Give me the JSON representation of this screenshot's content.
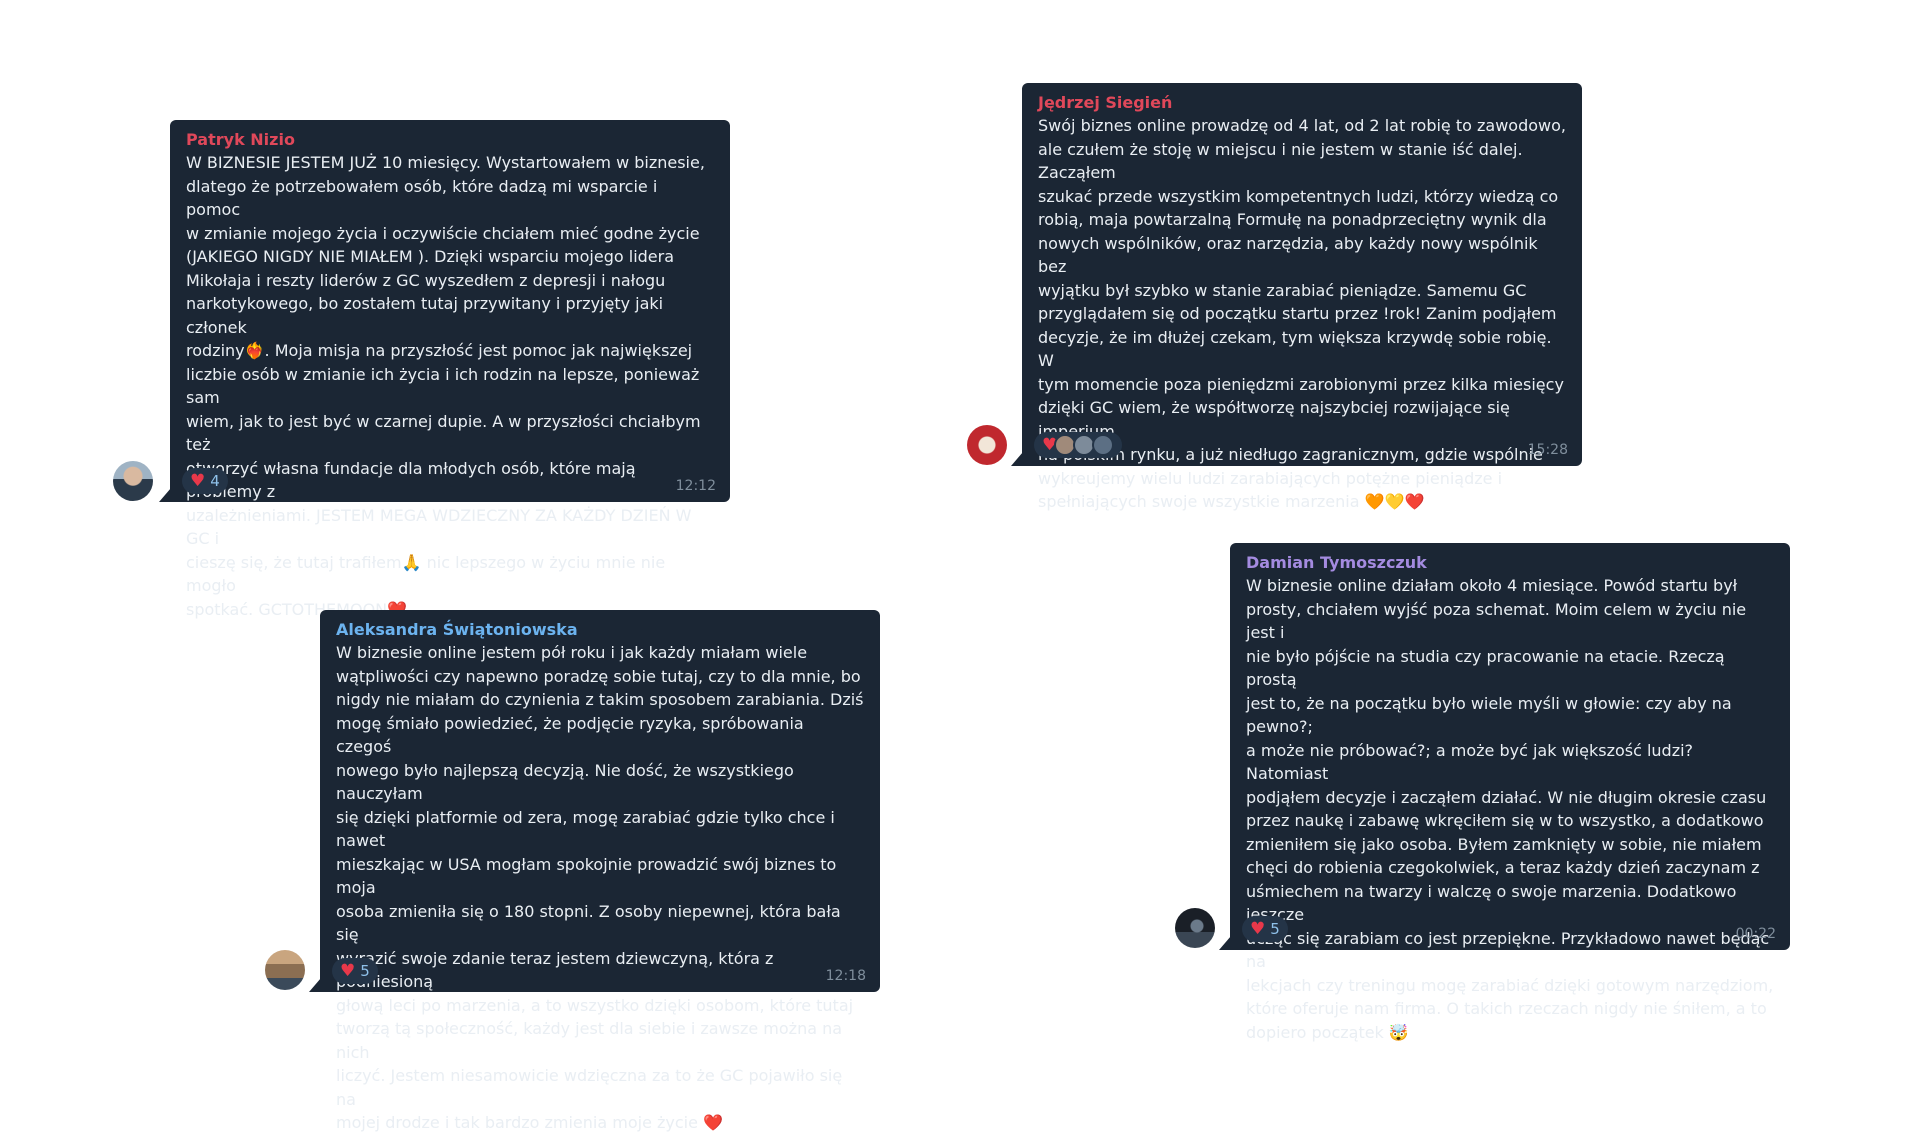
{
  "messages": {
    "patryk": {
      "sender": "Patryk Nizio",
      "sender_color": "#e0485a",
      "text": "W BIZNESIE JESTEM JUŻ 10 miesięcy. Wystartowałem w biznesie,\ndlatego że potrzebowałem osób, które dadzą mi wsparcie i pomoc\nw zmianie mojego życia i oczywiście chciałem mieć godne życie\n(JAKIEGO NIGDY NIE MIAŁEM ).  Dzięki wsparciu mojego lidera\nMikołaja i reszty liderów z GC wyszedłem z depresji i nałogu\nnarkotykowego, bo zostałem tutaj przywitany i przyjęty jaki członek\nrodziny❤️‍🔥. Moja misja na przyszłość jest pomoc jak największej\nliczbie osób w zmianie ich życia i ich rodzin na lepsze, ponieważ sam\nwiem, jak to jest być w czarnej dupie. A w przyszłości chciałbym też\notworzyć własna fundacje dla młodych osób, które mają problemy z\nuzależnieniami. JESTEM MEGA WDZIECZNY ZA KAŻDY DZIEŃ W GC i\ncieszę się, że tutaj trafiłem🙏 nic lepszego w życiu mnie nie mogło\nspotkać. GCTOTHEMOON❤️",
      "reaction_count": "4",
      "time": "12:12"
    },
    "jedrzej": {
      "sender": "Jędrzej Siegień",
      "sender_color": "#e0485a",
      "text": "Swój biznes online prowadzę od 4 lat, od 2 lat robię to zawodowo,\nale czułem że stoję w miejscu i nie jestem w stanie iść dalej. Zacząłem\nszukać przede wszystkim kompetentnych ludzi, którzy wiedzą co\nrobią, maja powtarzalną Formułę na ponadprzeciętny wynik dla\nnowych wspólników, oraz narzędzia, aby każdy nowy wspólnik bez\nwyjątku był szybko w stanie zarabiać pieniądze. Samemu GC\nprzyglądałem się od początku startu przez !rok! Zanim podjąłem\ndecyzje, że im dłużej czekam, tym większa krzywdę sobie robię. W\ntym momencie poza pieniędzmi zarobionymi przez kilka miesięcy\ndzięki GC wiem, że współtworzę najszybciej rozwijające się imperium\nna polskim rynku, a już niedługo zagranicznym, gdzie wspólnie\nwykreujemy wielu ludzi zarabiających potężne pieniądze i\nspełniających swoje wszystkie marzenia 🧡💛❤️",
      "time": "15:28"
    },
    "aleksandra": {
      "sender": "Aleksandra Świątoniowska",
      "sender_color": "#6cb3ef",
      "text": "W biznesie online jestem pół roku i jak każdy miałam wiele\nwątpliwości czy napewno poradzę sobie tutaj, czy to dla mnie, bo\nnigdy nie miałam do czynienia z takim sposobem zarabiania. Dziś\nmogę śmiało powiedzieć, że podjęcie ryzyka, spróbowania czegoś\nnowego było najlepszą decyzją. Nie dość, że wszystkiego nauczyłam\nsię dzięki platformie od zera, mogę zarabiać gdzie tylko chce i nawet\nmieszkając w USA  mogłam spokojnie prowadzić swój biznes to moja\nosoba zmieniła się o 180 stopni. Z osoby niepewnej, która bała się\nwyrazić swoje zdanie teraz jestem dziewczyną, która z podniesioną\ngłową leci po marzenia, a to wszystko dzięki osobom, które tutaj\ntworzą tą społeczność, każdy jest dla siebie i zawsze można na nich\nliczyć. Jestem niesamowicie wdzięczna za to że GC pojawiło się na\nmojej drodze i tak bardzo zmienia moje życie ❤️",
      "reaction_count": "5",
      "time": "12:18"
    },
    "damian": {
      "sender": "Damian Tymoszczuk",
      "sender_color": "#a48be0",
      "text": "W biznesie online działam około 4 miesiące. Powód startu był\nprosty, chciałem wyjść poza schemat. Moim celem w życiu nie jest i\nnie było pójście na studia czy pracowanie na etacie. Rzeczą prostą\njest to, że na początku było wiele myśli w głowie: czy aby na pewno?;\na może nie próbować?; a może być jak większość ludzi? Natomiast\npodjąłem decyzje i zacząłem działać. W nie długim okresie czasu\nprzez naukę i zabawę wkręciłem się w to wszystko, a dodatkowo\nzmieniłem się jako osoba. Byłem zamknięty w sobie, nie miałem\nchęci do robienia czegokolwiek, a teraz każdy dzień zaczynam z\nuśmiechem na twarzy i walczę o swoje marzenia. Dodatkowo jeszcze\nucząc się zarabiam co jest przepiękne. Przykładowo nawet będąc na\nlekcjach czy treningu mogę zarabiać dzięki gotowym narzędziom,\nktóre oferuje nam firma. O takich rzeczach nigdy nie śniłem, a to\ndopiero początek 🤯",
      "reaction_count": "5",
      "time": "00:22"
    }
  },
  "icons": {
    "reaction": "heart-icon",
    "avatar": "user-avatar"
  },
  "colors": {
    "bubble": "#1b2634",
    "text": "#e9eef3",
    "time": "#7f8e9c",
    "reaction_bg": "#243447",
    "heart": "#e8384a"
  }
}
